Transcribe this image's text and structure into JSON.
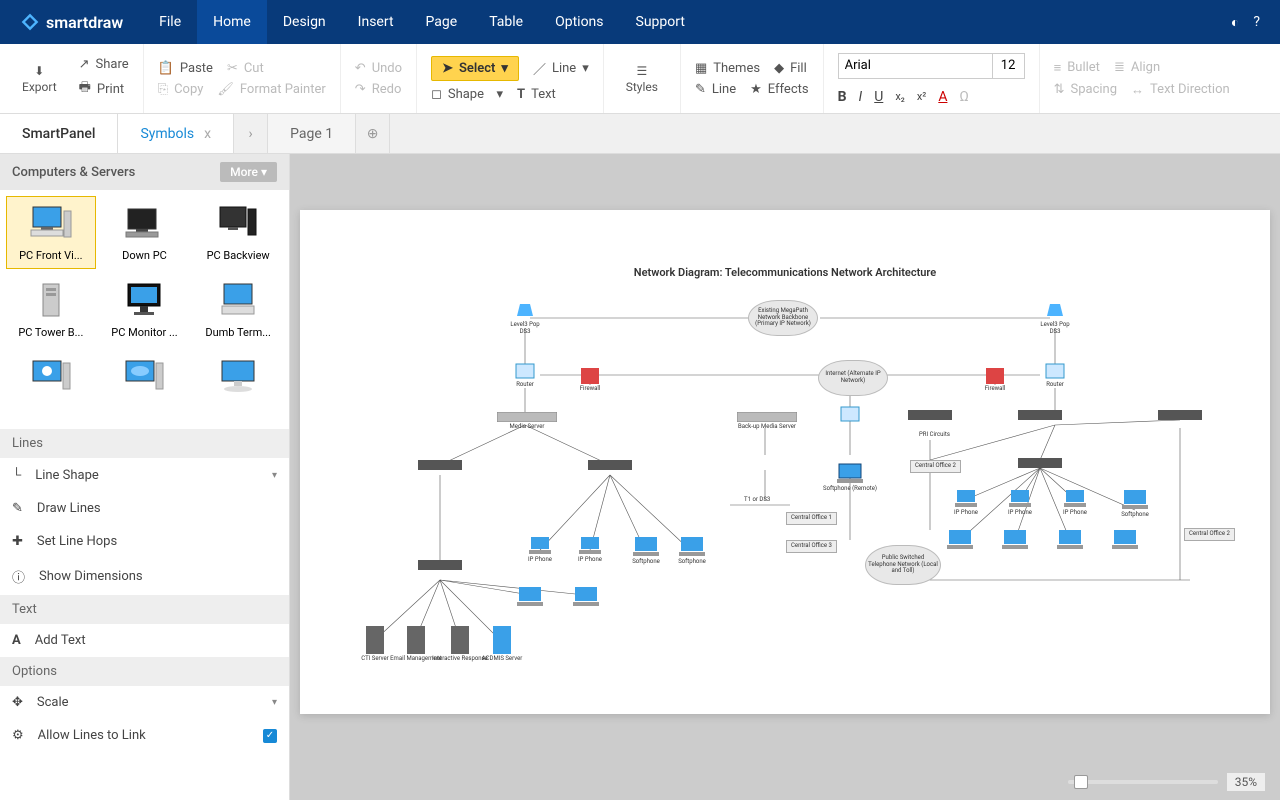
{
  "app": {
    "name": "smartdraw"
  },
  "menu": [
    "File",
    "Home",
    "Design",
    "Insert",
    "Page",
    "Table",
    "Options",
    "Support"
  ],
  "menu_active": 1,
  "ribbon": {
    "export": "Export",
    "share": "Share",
    "print": "Print",
    "paste": "Paste",
    "cut": "Cut",
    "copy": "Copy",
    "format_painter": "Format Painter",
    "undo": "Undo",
    "redo": "Redo",
    "select": "Select",
    "line": "Line",
    "shape": "Shape",
    "text": "Text",
    "styles": "Styles",
    "themes": "Themes",
    "fill": "Fill",
    "line2": "Line",
    "effects": "Effects",
    "bullet": "Bullet",
    "align": "Align",
    "spacing": "Spacing",
    "text_direction": "Text Direction"
  },
  "font": {
    "name": "Arial",
    "size": "12"
  },
  "tabs": {
    "smartpanel": "SmartPanel",
    "symbols": "Symbols",
    "page1": "Page 1"
  },
  "panel": {
    "library": "Computers & Servers",
    "more": "More",
    "symbols": [
      "PC Front Vi...",
      "Down PC",
      "PC Backview",
      "PC Tower B...",
      "PC Monitor ...",
      "Dumb Term..."
    ],
    "lines_hdr": "Lines",
    "line_shape": "Line Shape",
    "draw_lines": "Draw Lines",
    "set_line_hops": "Set Line Hops",
    "show_dimensions": "Show Dimensions",
    "text_hdr": "Text",
    "add_text": "Add Text",
    "options_hdr": "Options",
    "scale": "Scale",
    "allow_lines": "Allow Lines to Link"
  },
  "diagram": {
    "title": "Network Diagram: Telecommunications Network Architecture",
    "nodes": {
      "l3pop_l": "Level3 Pop",
      "l3pop_r": "Level3 Pop",
      "ds3_l": "DS3",
      "ds3_r": "DS3",
      "backbone": "Existing MegaPath Network Backbone (Primary IP Network)",
      "internet": "Internet (Alternate IP Network)",
      "router_l": "Router",
      "router_r": "Router",
      "firewall_l": "Firewall",
      "firewall_r": "Firewall",
      "media": "Media Server",
      "backup": "Back-up Media Server",
      "softphone_remote": "Softphone (Remote)",
      "pri": "PRI Circuits",
      "co1": "Central Office 1",
      "co2": "Central Office 2",
      "co3": "Central Office 3",
      "co2r": "Central Office 2",
      "t1": "T1 or DS3",
      "pstn": "Public Switched Telephone Network (Local and Toll)",
      "ipphone": "IP Phone",
      "softphone": "Softphone",
      "cti": "CTI Server",
      "email": "Email Management",
      "ivr": "Interactive Response",
      "acd": "ACDMIS Server"
    }
  },
  "zoom": "35%"
}
